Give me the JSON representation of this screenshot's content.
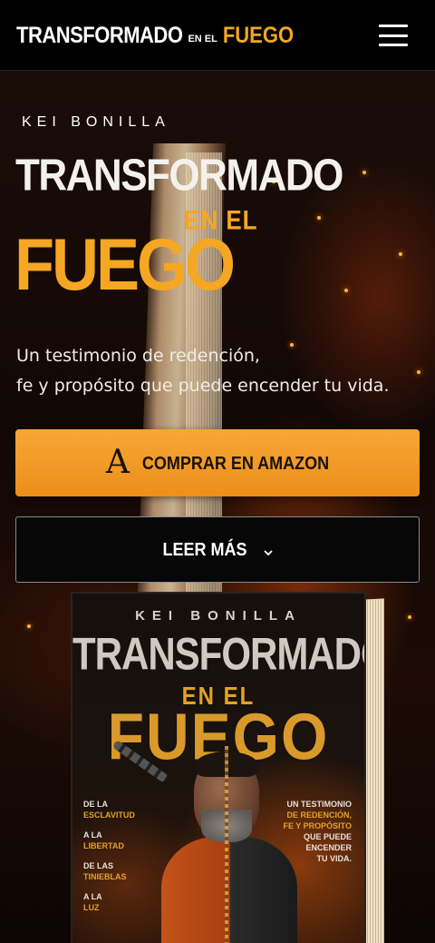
{
  "header": {
    "logo_main": "TRANSFORMADO",
    "logo_small": "EN EL",
    "logo_accent": "FUEGO",
    "menu_icon": "hamburger-menu-icon"
  },
  "hero": {
    "author": "KEI BONILLA",
    "title_main": "TRANSFORMADO",
    "title_mid": "EN EL",
    "title_big": "FUEGO",
    "tagline_line1": "Un testimonio de redención,",
    "tagline_line2": "fe y propósito que puede encender tu vida."
  },
  "buttons": {
    "amazon_icon": "A",
    "amazon_label": "COMPRAR EN AMAZON",
    "more_label": "LEER MÁS"
  },
  "cover": {
    "author": "KEI BONILLA",
    "title": "TRANSFORMADO",
    "sub": "EN EL",
    "big": "FUEGO",
    "left_lines": [
      {
        "a": "DE LA",
        "b": "ESCLAVITUD"
      },
      {
        "a": "A LA",
        "b": "LIBERTAD"
      },
      {
        "a": "DE LAS",
        "b": "TINIEBLAS"
      },
      {
        "a": "A LA",
        "b": "LUZ"
      }
    ],
    "right_lines": [
      "UN TESTIMONIO",
      "DE REDENCIÓN,",
      "FE Y PROPÓSITO",
      "QUE PUEDE",
      "ENCENDER",
      "TU VIDA."
    ]
  },
  "colors": {
    "accent": "#f5a623",
    "button_amazon": "#f09a25",
    "background": "#0a0605"
  }
}
